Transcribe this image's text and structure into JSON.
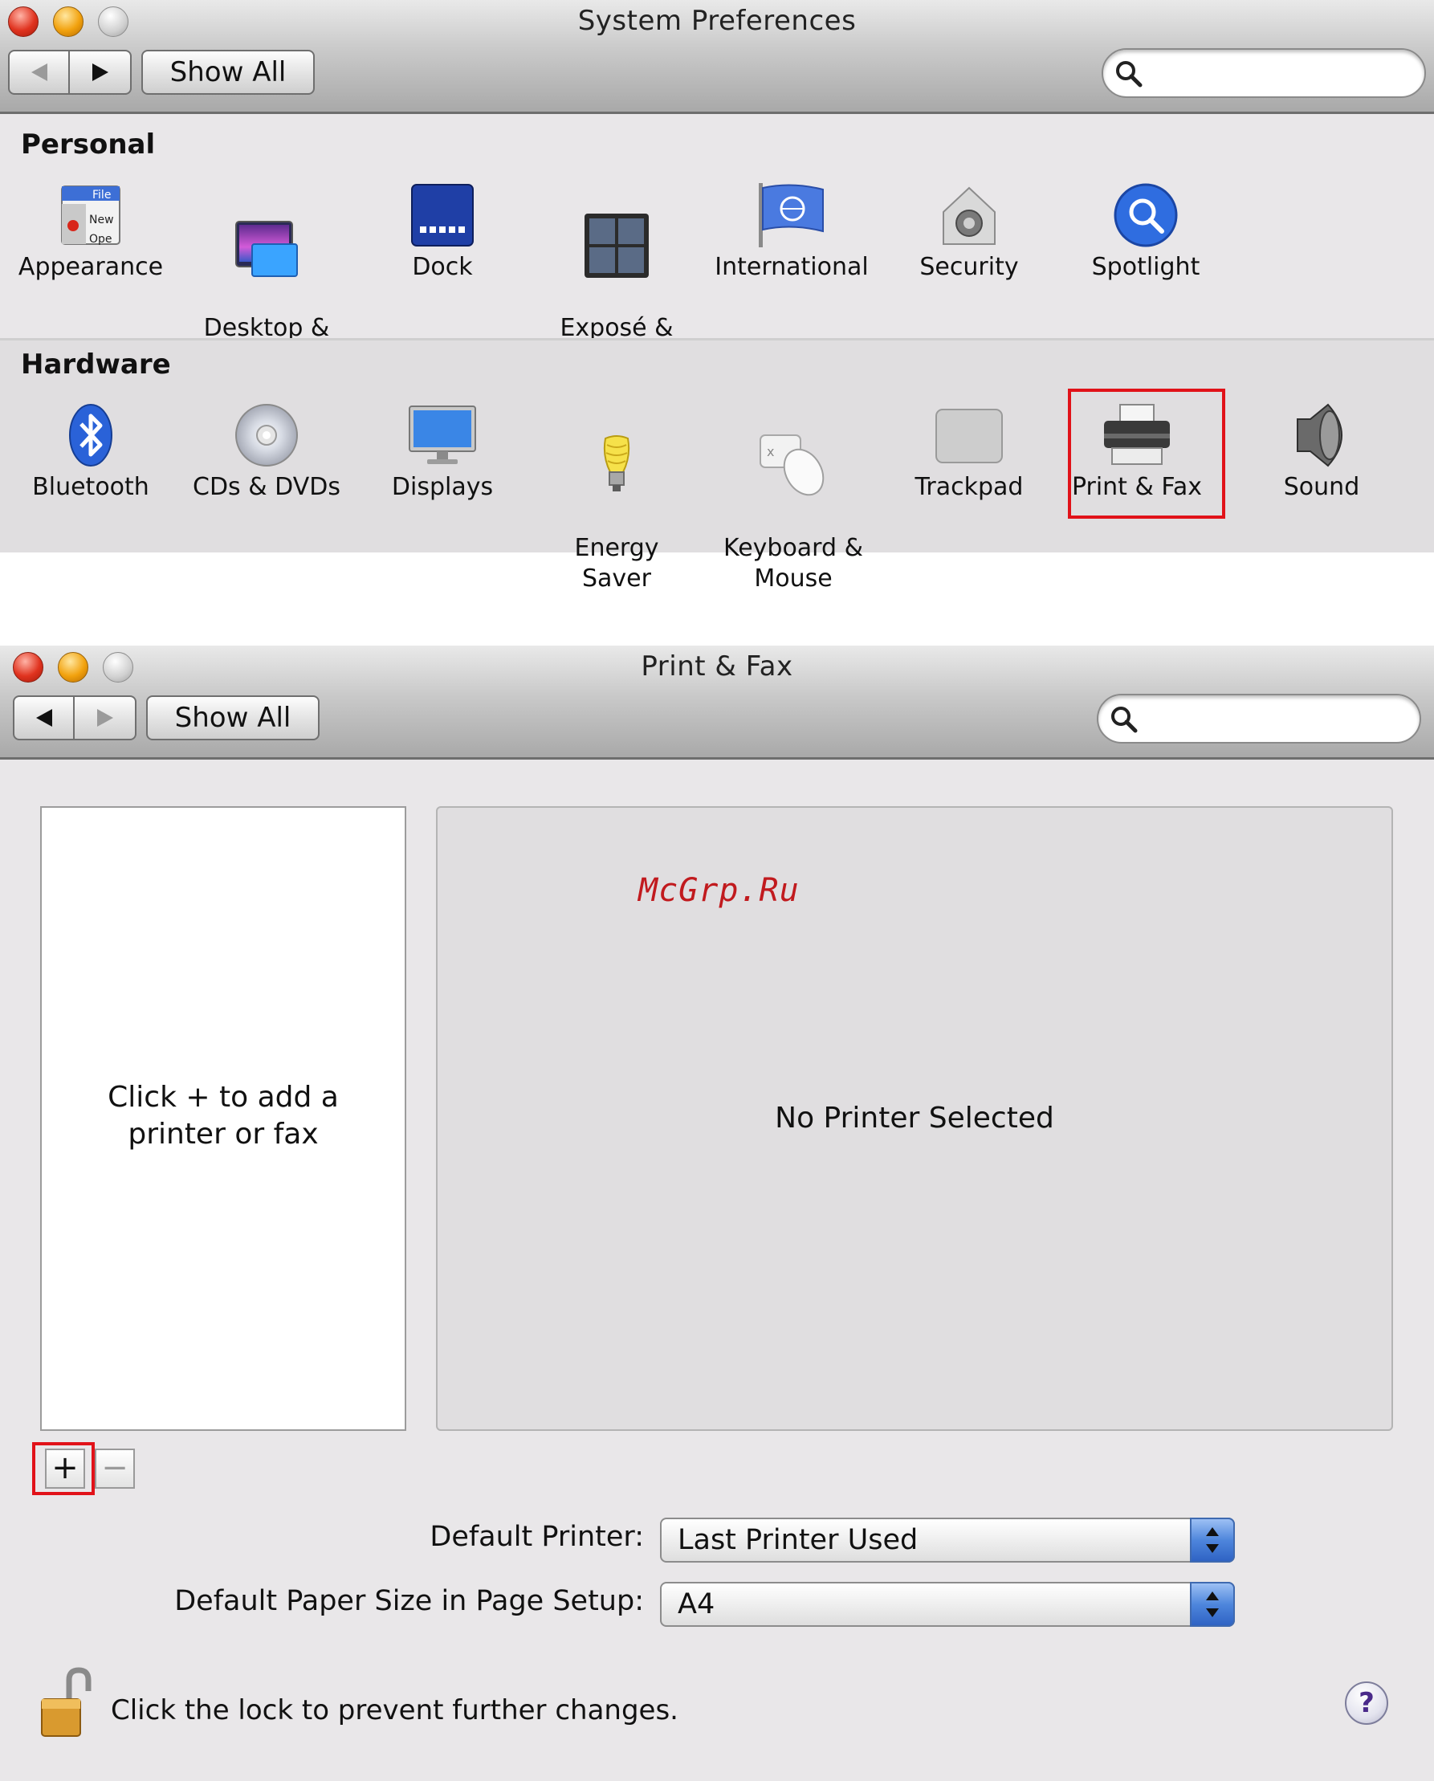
{
  "sysprefs": {
    "title": "System Preferences",
    "show_all": "Show All",
    "search_placeholder": "",
    "sections": {
      "personal": "Personal",
      "hardware": "Hardware"
    },
    "personal_items": [
      {
        "label": "Appearance",
        "icon": "appearance-icon"
      },
      {
        "label": "Desktop &\nScreen Saver",
        "icon": "desktop-icon"
      },
      {
        "label": "Dock",
        "icon": "dock-icon"
      },
      {
        "label": "Exposé &\nSpaces",
        "icon": "expose-icon"
      },
      {
        "label": "International",
        "icon": "international-icon"
      },
      {
        "label": "Security",
        "icon": "security-icon"
      },
      {
        "label": "Spotlight",
        "icon": "spotlight-icon"
      }
    ],
    "hardware_items": [
      {
        "label": "Bluetooth",
        "icon": "bluetooth-icon"
      },
      {
        "label": "CDs & DVDs",
        "icon": "cd-icon"
      },
      {
        "label": "Displays",
        "icon": "display-icon"
      },
      {
        "label": "Energy\nSaver",
        "icon": "bulb-icon"
      },
      {
        "label": "Keyboard &\nMouse",
        "icon": "keyboard-mouse-icon"
      },
      {
        "label": "Trackpad",
        "icon": "trackpad-icon"
      },
      {
        "label": "Print & Fax",
        "icon": "printer-icon"
      },
      {
        "label": "Sound",
        "icon": "speaker-icon"
      }
    ],
    "highlight_color": "#e11219"
  },
  "printfax": {
    "title": "Print & Fax",
    "show_all": "Show All",
    "search_placeholder": "",
    "list_hint": "Click + to add a printer or fax",
    "no_selection": "No Printer Selected",
    "watermark": "McGrp.Ru",
    "add_symbol": "+",
    "remove_symbol": "−",
    "default_printer_label": "Default Printer:",
    "default_printer_value": "Last Printer Used",
    "paper_size_label": "Default Paper Size in Page Setup:",
    "paper_size_value": "A4",
    "lock_text": "Click the lock to prevent further changes.",
    "help_symbol": "?"
  }
}
